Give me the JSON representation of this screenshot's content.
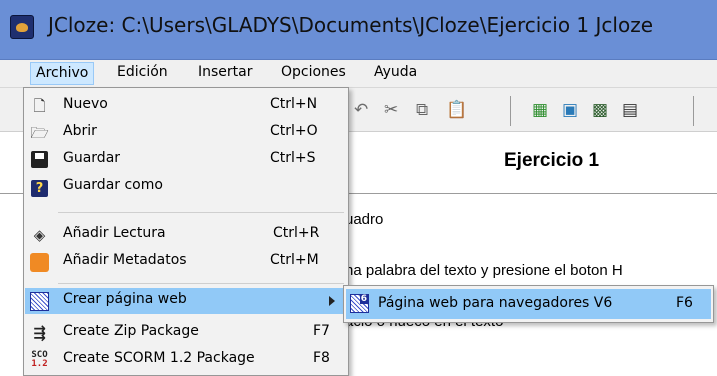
{
  "window": {
    "title": "JCloze: C:\\Users\\GLADYS\\Documents\\JCloze\\Ejercicio 1 Jcloze",
    "app_icon": "jcloze-app-icon"
  },
  "menubar": {
    "items": [
      {
        "label": "Archivo",
        "active": true
      },
      {
        "label": "Edición"
      },
      {
        "label": "Insertar"
      },
      {
        "label": "Opciones"
      },
      {
        "label": "Ayuda"
      }
    ]
  },
  "toolbar": {
    "icons": [
      "undo-icon",
      "cut-icon",
      "copy-icon",
      "paste-icon",
      "web-icon",
      "edit-icon",
      "gap-icon",
      "clue-icon"
    ]
  },
  "document": {
    "title": "Ejercicio 1",
    "lines": [
      "uadro",
      "na palabra del texto y presione el boton H",
      "acio o hueco en el texto"
    ]
  },
  "file_menu": {
    "items": [
      {
        "label": "Nuevo",
        "shortcut": "Ctrl+N",
        "icon": "new-document-icon"
      },
      {
        "label": "Abrir",
        "shortcut": "Ctrl+O",
        "icon": "open-folder-icon"
      },
      {
        "label": "Guardar",
        "shortcut": "Ctrl+S",
        "icon": "save-icon"
      },
      {
        "label": "Guardar como",
        "shortcut": "",
        "icon": "save-as-icon"
      },
      {
        "label": "Añadir Lectura",
        "shortcut": "Ctrl+R",
        "icon": "reading-icon"
      },
      {
        "label": "Añadir Metadatos",
        "shortcut": "Ctrl+M",
        "icon": "metadata-icon"
      },
      {
        "label": "Crear página web",
        "shortcut": "",
        "icon": "web-page-icon",
        "highlighted": true,
        "has_submenu": true
      },
      {
        "label": "Create Zip Package",
        "shortcut": "F7",
        "icon": "zip-icon"
      },
      {
        "label": "Create SCORM 1.2 Package",
        "shortcut": "F8",
        "icon": "scorm-icon"
      }
    ]
  },
  "submenu": {
    "label": "Página web para navegadores V6",
    "shortcut": "F6",
    "icon": "web-v6-icon",
    "icon_badge": "6"
  },
  "colors": {
    "titlebar": "#6a8fd6",
    "menu_highlight": "#91c9f7",
    "menubar_active": "#cde8ff"
  }
}
